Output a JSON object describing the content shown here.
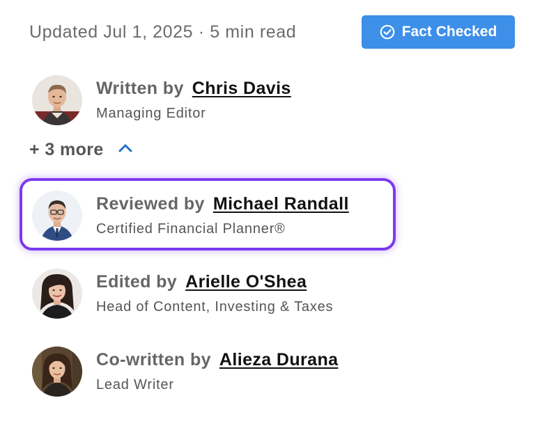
{
  "meta": {
    "updated_text": "Updated Jul 1, 2025 · 5 min read",
    "fact_checked_label": "Fact Checked",
    "badge_color": "#3d8fe8"
  },
  "authors": {
    "writer": {
      "role": "Written by",
      "name": "Chris Davis",
      "title": "Managing Editor"
    },
    "more_toggle": {
      "label": "+ 3 more",
      "icon": "chevron-up-icon",
      "expanded": true
    },
    "reviewer": {
      "role": "Reviewed by",
      "name": "Michael Randall",
      "title": "Certified Financial Planner®",
      "highlight_color": "#7c3aed"
    },
    "editor": {
      "role": "Edited by",
      "name": "Arielle O'Shea",
      "title": "Head of Content, Investing & Taxes"
    },
    "cowriter": {
      "role": "Co-written by",
      "name": "Alieza Durana",
      "title": "Lead Writer"
    }
  }
}
